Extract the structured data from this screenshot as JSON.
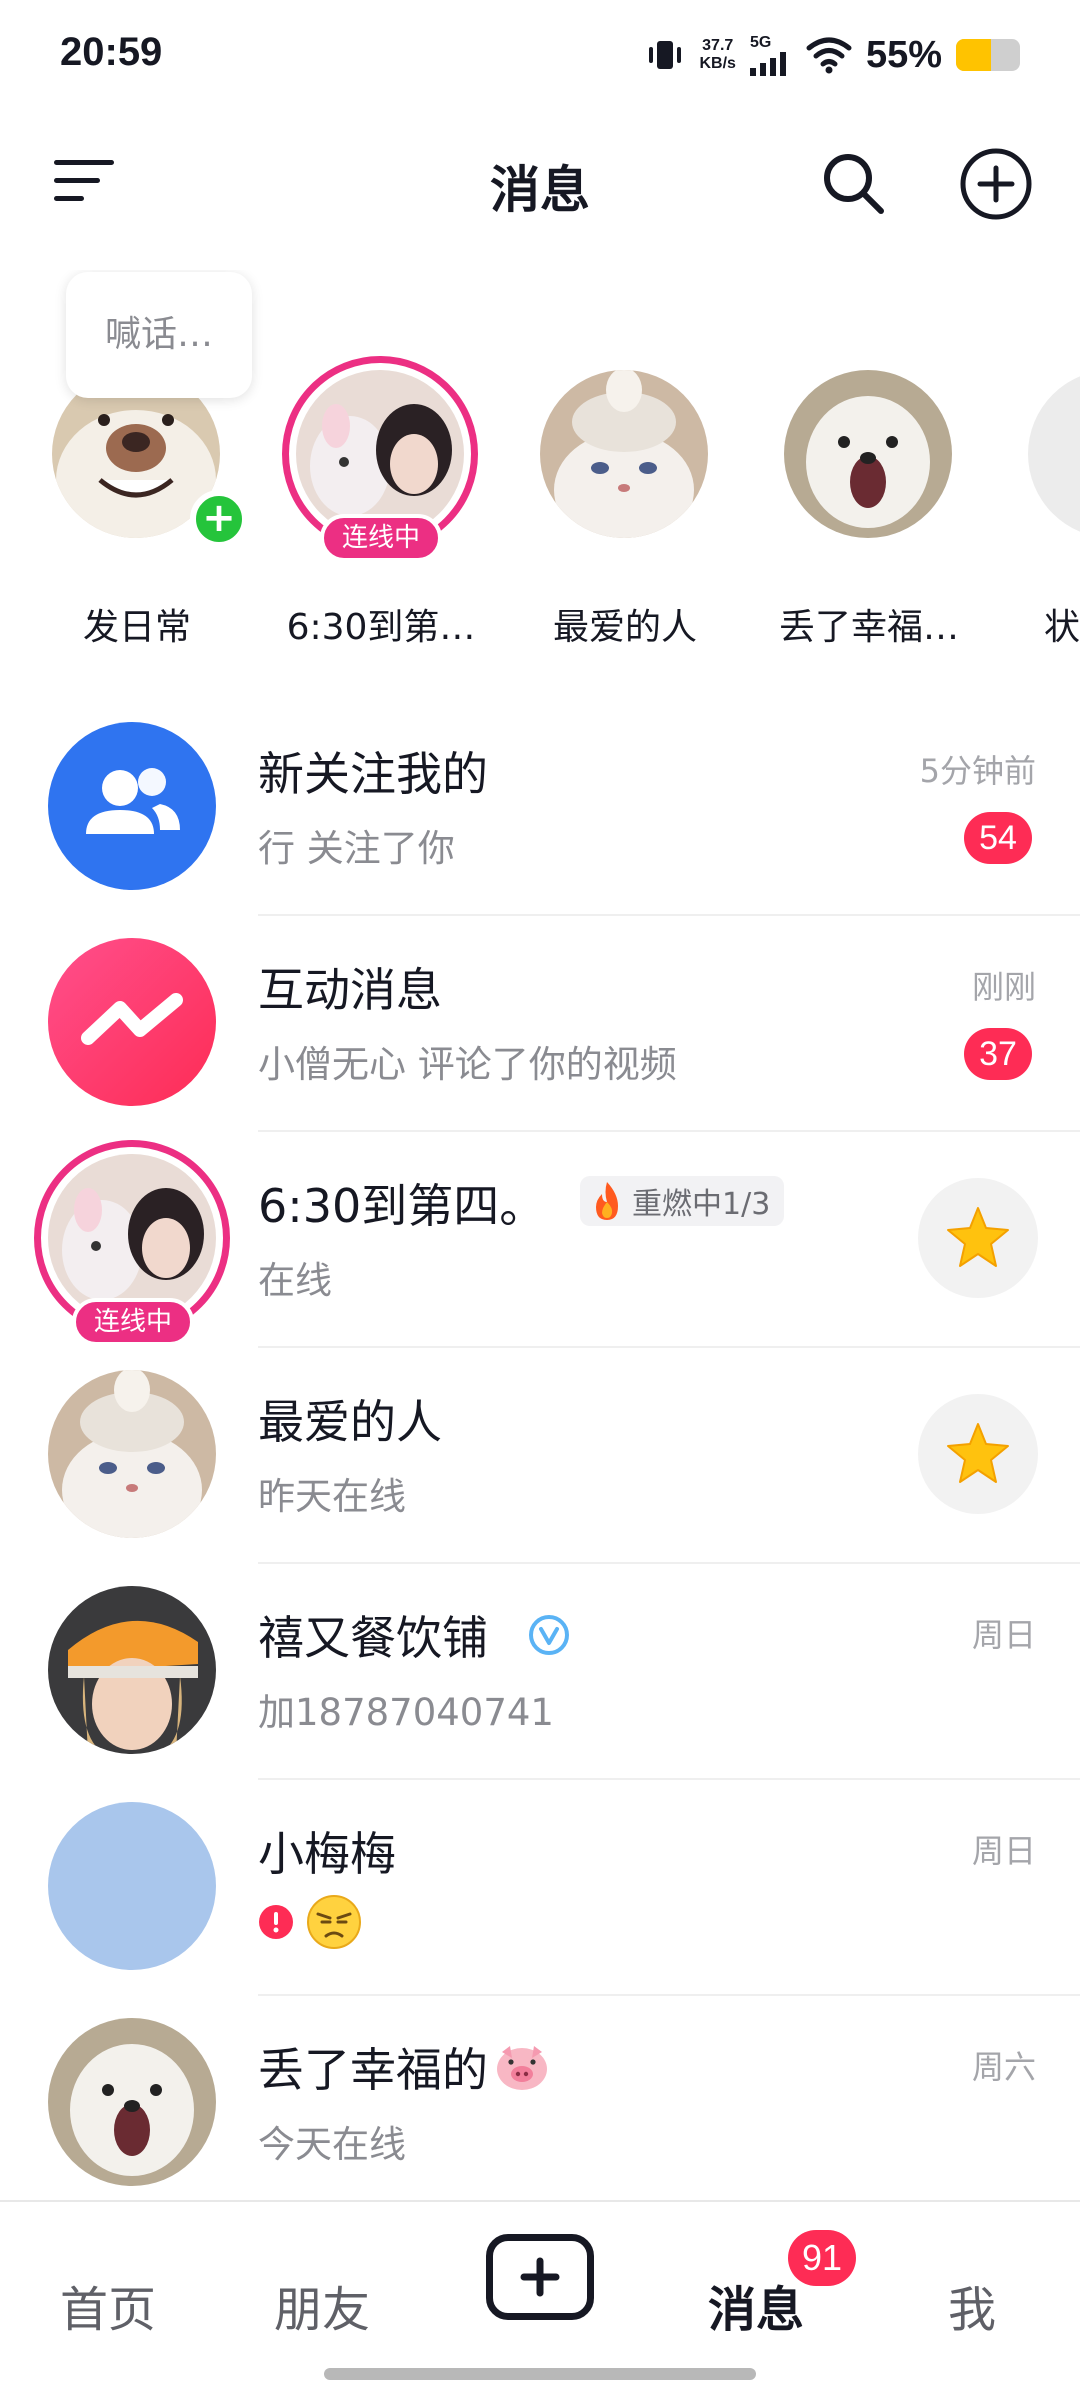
{
  "status_bar": {
    "time": "20:59",
    "net_speed_value": "37.7",
    "net_speed_unit": "KB/s",
    "network": "5G",
    "battery_percent": "55%",
    "battery_level": 0.55,
    "battery_color": "#ffc300",
    "icons": [
      "vibrate-icon",
      "signal-icon",
      "wifi-icon",
      "battery-icon"
    ]
  },
  "header": {
    "title": "消息",
    "icons": [
      "menu-icon",
      "search-icon",
      "add-circle-icon"
    ]
  },
  "stories": {
    "bubble_text": "喊话…",
    "items": [
      {
        "label": "发日常",
        "badge": "+"
      },
      {
        "label": "6:30到第…",
        "badge": "连线中"
      },
      {
        "label": "最爱的人"
      },
      {
        "label": "丢了幸福…"
      },
      {
        "label": "状"
      }
    ]
  },
  "messages": [
    {
      "name": "新关注我的",
      "subtitle": "行 关注了你",
      "time": "5分钟前",
      "count": "54",
      "icon": "users-icon",
      "color": "#2f74f0"
    },
    {
      "name": "互动消息",
      "subtitle": "小僧无心 评论了你的视频",
      "time": "刚刚",
      "count": "37",
      "icon": "interaction-icon",
      "color": "#fe2c6a"
    },
    {
      "name": "6:30到第四。",
      "subtitle": "在线",
      "tag": "重燃中1/3",
      "live_badge": "连线中"
    },
    {
      "name": "最爱的人",
      "subtitle": "昨天在线"
    },
    {
      "name": "禧又餐饮铺",
      "subtitle": "加18787040741",
      "time": "周日"
    },
    {
      "name": "小梅梅",
      "time": "周日"
    },
    {
      "name": "丢了幸福的",
      "subtitle": "今天在线",
      "time": "周六"
    }
  ],
  "bottom_nav": {
    "items": [
      "首页",
      "朋友",
      "消息",
      "我"
    ],
    "active": "消息",
    "message_badge": "91",
    "accent": "#fe2c55"
  }
}
